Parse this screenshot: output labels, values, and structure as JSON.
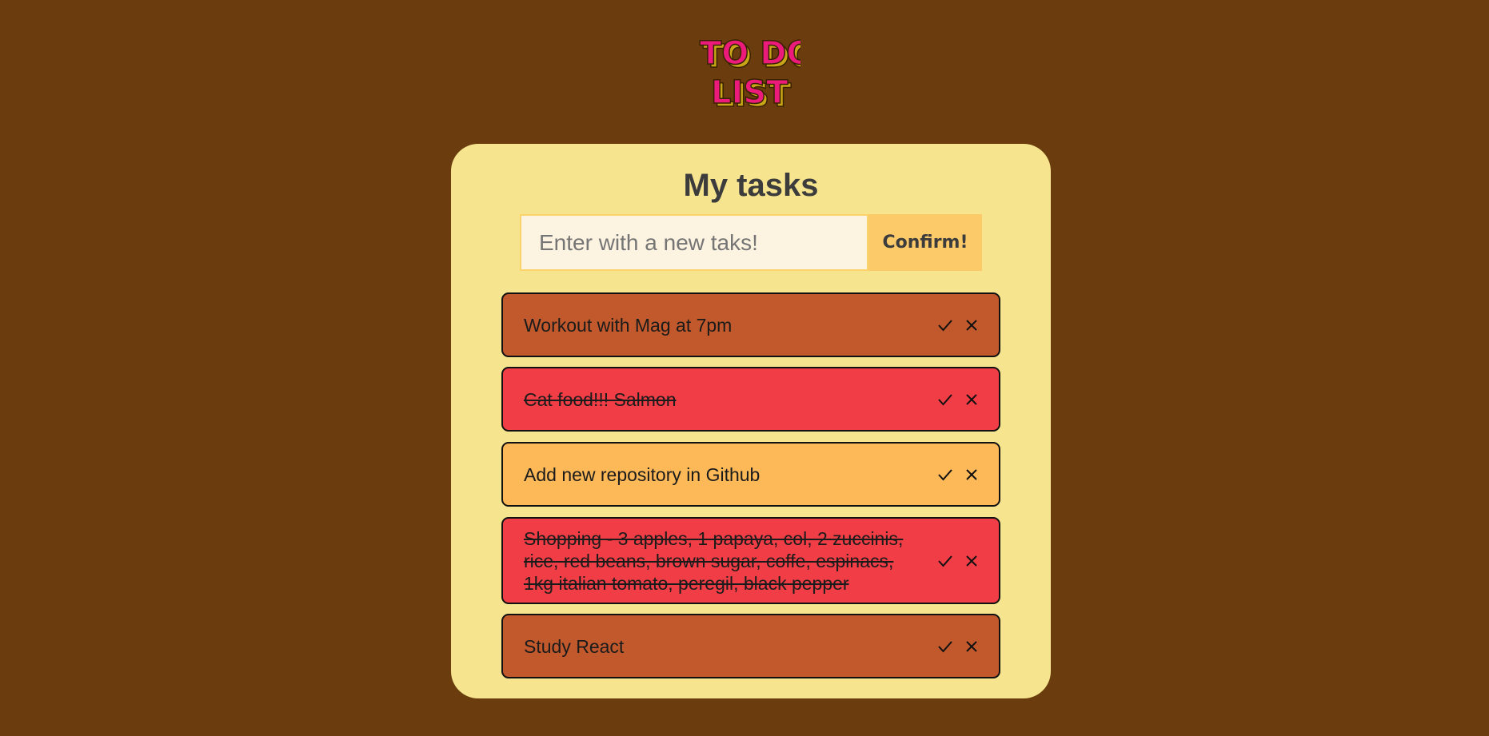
{
  "logo": {
    "line1": "TO DO",
    "line2": "LIST"
  },
  "card": {
    "title": "My tasks"
  },
  "new_task": {
    "placeholder": "Enter with a new taks!",
    "value": "",
    "confirm_label": "Confirm!"
  },
  "colors": {
    "page_background": "#6b3d0e",
    "card_background": "#f6e58e",
    "task_orange": "#c1592c",
    "task_red": "#f13d45",
    "task_yellow": "#fdb958"
  },
  "tasks": [
    {
      "text": "Workout with Mag at 7pm",
      "completed": false,
      "color": "#c1592c",
      "complete_icon": "check-icon",
      "delete_icon": "close-icon"
    },
    {
      "text": "Cat food!!! Salmon",
      "completed": true,
      "color": "#f13d45",
      "complete_icon": "check-icon",
      "delete_icon": "close-icon"
    },
    {
      "text": "Add new repository in Github",
      "completed": false,
      "color": "#fdb958",
      "complete_icon": "check-icon",
      "delete_icon": "close-icon"
    },
    {
      "text": "Shopping - 3 apples, 1 papaya, col, 2 zuccinis, rice, red beans, brown sugar, coffe, espinacs, 1kg italian tomato, peregil, black pepper",
      "completed": true,
      "color": "#f13d45",
      "complete_icon": "check-icon",
      "delete_icon": "close-icon"
    },
    {
      "text": "Study React",
      "completed": false,
      "color": "#c1592c",
      "complete_icon": "check-icon",
      "delete_icon": "close-icon"
    }
  ]
}
